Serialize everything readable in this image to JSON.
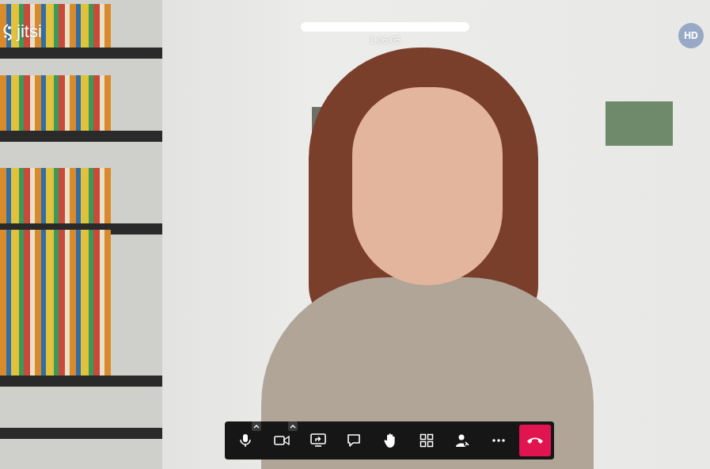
{
  "logo": {
    "label": "jitsi"
  },
  "header": {
    "timer": "1:06:05"
  },
  "badge": {
    "label": "HD"
  },
  "toolbar": {
    "buttons": [
      {
        "kind": "mic",
        "has_menu": true
      },
      {
        "kind": "camera",
        "has_menu": true
      },
      {
        "kind": "share",
        "has_menu": false
      },
      {
        "kind": "chat",
        "has_menu": false
      },
      {
        "kind": "hand",
        "has_menu": false
      },
      {
        "kind": "tiles",
        "has_menu": false
      },
      {
        "kind": "invite",
        "has_menu": false
      },
      {
        "kind": "more",
        "has_menu": false
      },
      {
        "kind": "hangup",
        "has_menu": false
      }
    ]
  }
}
